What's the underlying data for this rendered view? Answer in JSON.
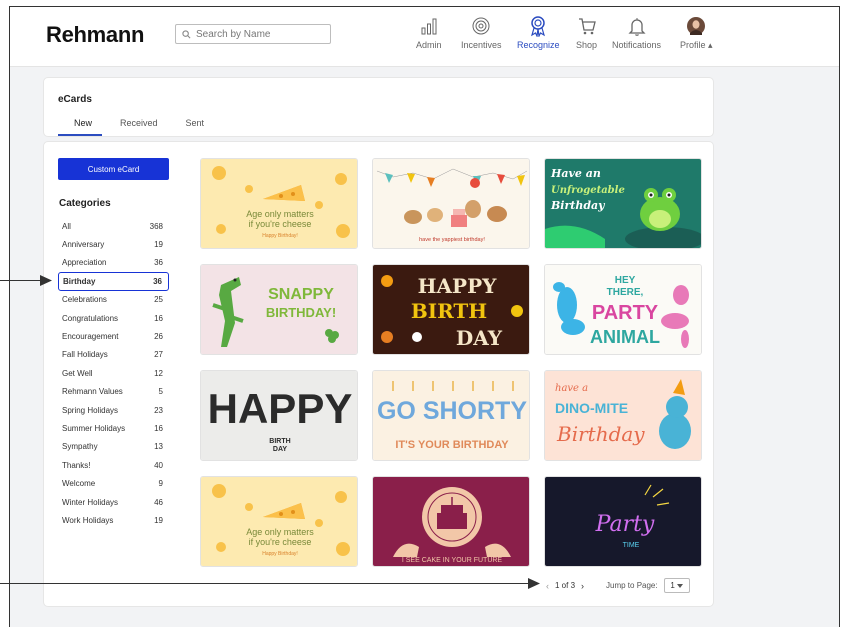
{
  "header": {
    "logo": "Rehmann",
    "search_placeholder": "Search by Name",
    "nav": [
      {
        "label": "Admin",
        "icon": "bar-chart-icon"
      },
      {
        "label": "Incentives",
        "icon": "badge-icon"
      },
      {
        "label": "Recognize",
        "icon": "ribbon-icon",
        "active": true
      },
      {
        "label": "Shop",
        "icon": "cart-icon"
      },
      {
        "label": "Notifications",
        "icon": "bell-icon"
      },
      {
        "label": "Profile ▴",
        "icon": "avatar"
      }
    ]
  },
  "ecards": {
    "title": "eCards",
    "tabs": [
      "New",
      "Received",
      "Sent"
    ],
    "active_tab": "New"
  },
  "sidebar": {
    "custom_button": "Custom eCard",
    "categories_title": "Categories",
    "categories": [
      {
        "name": "All",
        "count": "368"
      },
      {
        "name": "Anniversary",
        "count": "19"
      },
      {
        "name": "Appreciation",
        "count": "36"
      },
      {
        "name": "Birthday",
        "count": "36",
        "selected": true
      },
      {
        "name": "Celebrations",
        "count": "25"
      },
      {
        "name": "Congratulations",
        "count": "16"
      },
      {
        "name": "Encouragement",
        "count": "26"
      },
      {
        "name": "Fall Holidays",
        "count": "27"
      },
      {
        "name": "Get Well",
        "count": "12"
      },
      {
        "name": "Rehmann Values",
        "count": "5"
      },
      {
        "name": "Spring Holidays",
        "count": "23"
      },
      {
        "name": "Summer Holidays",
        "count": "16"
      },
      {
        "name": "Sympathy",
        "count": "13"
      },
      {
        "name": "Thanks!",
        "count": "40"
      },
      {
        "name": "Welcome",
        "count": "9"
      },
      {
        "name": "Winter Holidays",
        "count": "46"
      },
      {
        "name": "Work Holidays",
        "count": "19"
      }
    ]
  },
  "cards": {
    "c1": {
      "line1": "Age only matters",
      "line2": "if you're cheese",
      "line3": "Happy Birthday!"
    },
    "c2": {
      "line1": "have the yappiest birthday!"
    },
    "c3": {
      "line1": "Have an",
      "line2": "Unfrogetable",
      "line3": "Birthday"
    },
    "c4": {
      "line1": "SNAPPY",
      "line2": "BIRTHDAY!"
    },
    "c5": {
      "line1": "HAPPY",
      "line2": "BIRTH",
      "line3": "DAY"
    },
    "c6": {
      "line1": "HEY",
      "line2": "THERE,",
      "line3": "PARTY",
      "line4": "ANIMAL"
    },
    "c7": {
      "line1": "HAPPY",
      "line2": "BIRTH",
      "line3": "DAY"
    },
    "c8": {
      "line1": "GO SHORTY",
      "line2": "IT'S YOUR BIRTHDAY"
    },
    "c9": {
      "line1": "have a",
      "line2": "DINO-MITE",
      "line3": "Birthday"
    },
    "c10": {
      "line1": "Age only matters",
      "line2": "if you're cheese",
      "line3": "Happy Birthday!"
    },
    "c11": {
      "line1": "I SEE CAKE IN YOUR FUTURE"
    },
    "c12": {
      "line1": "Party",
      "line2": "TIME"
    }
  },
  "pagination": {
    "prev": "‹",
    "label": "1 of 3",
    "next": "›",
    "jump_label": "Jump to Page:",
    "page_value": "1"
  },
  "colors": {
    "accent": "#1733d6",
    "active_nav": "#2b4cc0"
  }
}
